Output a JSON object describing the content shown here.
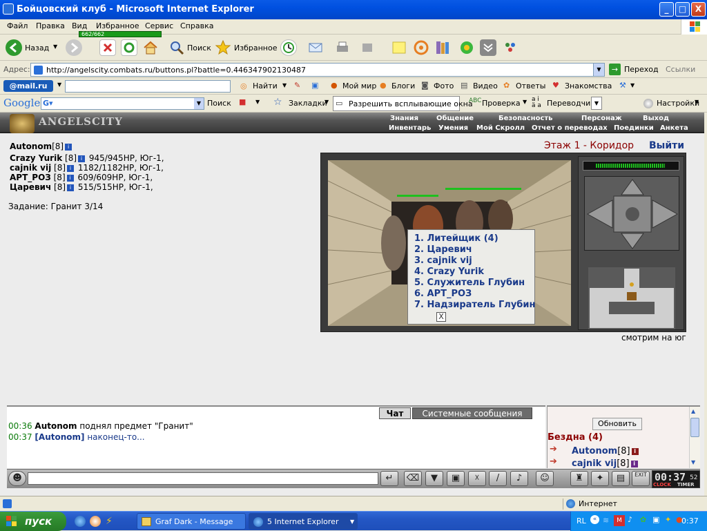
{
  "window": {
    "title": "Бойцовский клуб - Microsoft Internet Explorer",
    "controls": [
      "_",
      "□",
      "X"
    ]
  },
  "menu": [
    "Файл",
    "Правка",
    "Вид",
    "Избранное",
    "Сервис",
    "Справка"
  ],
  "toolbar": {
    "back": "Назад",
    "search": "Поиск",
    "favorites": "Избранное"
  },
  "address": {
    "label": "Адрес:",
    "url": "http://angelscity.combats.ru/buttons.pl?battle=0.446347902130487",
    "go": "Переход",
    "links": "Ссылки"
  },
  "mailru": {
    "logo": "@mail.ru",
    "find": "Найти",
    "items": [
      "Мой мир",
      "Блоги",
      "Фото",
      "Видео",
      "Ответы",
      "Знакомства"
    ]
  },
  "google": {
    "logo": "Google",
    "search": "Поиск",
    "bookmarks": "Закладки",
    "popup": "Разрешить всплывающие окна",
    "check": "Проверка",
    "translate": "Переводчик",
    "settings": "Настройки"
  },
  "game": {
    "logo": "ANGELSCITY",
    "nav_top": [
      "Знания",
      "Общение",
      "Безопасность",
      "Персонаж",
      "Выход"
    ],
    "nav_bottom": [
      "Инвентарь",
      "Умения",
      "Мой Скролл",
      "Отчет о переводах",
      "Поединки",
      "Анкета"
    ],
    "player": {
      "name": "Autonom",
      "level": "[8]",
      "hp": "662/662",
      "hp_fraction": 1.0
    },
    "party": [
      {
        "name": "Crazy Yurik",
        "level": "[8]",
        "hp": "945/945HP, Юг-1,"
      },
      {
        "name": "cajnik vij",
        "level": "[8]",
        "hp": "1182/1182HP, Юг-1,"
      },
      {
        "name": "АРТ_РОЗ",
        "level": "[8]",
        "hp": "609/609HP, Юг-1,"
      },
      {
        "name": "Царевич",
        "level": "[8]",
        "hp": "515/515HP, Юг-1,"
      }
    ],
    "task": "Задание: Гранит 3/14",
    "floor": "Этаж 1 - Коридор",
    "exit": "Выйти",
    "popup_list": [
      "1. Литейщик (4)",
      "2. Царевич",
      "3. cajnik vij",
      "4. Crazy Yurik",
      "5. Служитель Глубин",
      "6. АРТ_РОЗ",
      "7. Надзиратель Глубин"
    ],
    "popup_close": "X",
    "facing": "смотрим на юг",
    "chat_tabs": [
      "Чат",
      "Системные сообщения"
    ],
    "chat": [
      {
        "time": "00:36",
        "text_bold": "Autonom",
        "text": " поднял предмет \"Гранит\""
      },
      {
        "time": "00:37",
        "text_bold": "[Autonom]",
        "text": " наконец-то..."
      }
    ],
    "refresh": "Обновить",
    "location": "Бездна (4)",
    "users": [
      {
        "name": "Autonom",
        "level": "[8]"
      },
      {
        "name": "cajnik vij",
        "level": "[8]"
      }
    ],
    "clock": "00:37",
    "clock_sec": "52",
    "clock_label": "CLOCK",
    "timer_label": "TIMER",
    "exit_label": "EXIT"
  },
  "statusbar": {
    "zone": "Интернет"
  },
  "taskbar": {
    "start": "пуск",
    "tasks": [
      "Graf Dark - Message",
      "5 Internet Explorer"
    ],
    "lang": "RL",
    "time": "0:37"
  },
  "colors": {
    "xp_blue": "#0050e0",
    "hp_green": "#1a9a1a",
    "floor_red": "#8b0000",
    "link_blue": "#1a3a8a"
  }
}
